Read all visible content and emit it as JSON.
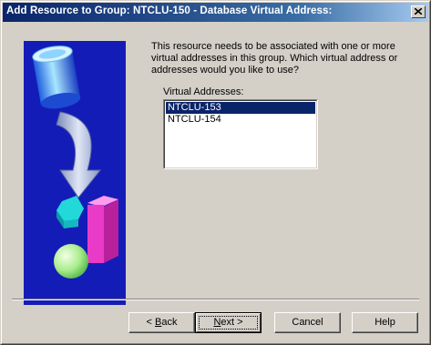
{
  "window": {
    "title": "Add Resource to Group: NTCLU-150 - Database Virtual Address:"
  },
  "message": "This resource needs to be associated with one or more virtual addresses in this group.  Which virtual address or addresses would you like to use?",
  "virtual_addresses": {
    "label": "Virtual Addresses:",
    "items": [
      "NTCLU-153",
      "NTCLU-154"
    ],
    "selected": "NTCLU-153"
  },
  "buttons": {
    "back": {
      "prefix": "< ",
      "mnemonic": "B",
      "rest": "ack"
    },
    "next": {
      "mnemonic": "N",
      "rest": "ext >"
    },
    "cancel": "Cancel",
    "help": "Help"
  },
  "icons": {
    "titlebar_close": "close-icon",
    "wizard_art": "database-cylinder-arrow-shapes-illustration"
  },
  "colors": {
    "titlebar_start": "#0a246a",
    "titlebar_end": "#a6caf0",
    "selection": "#0a246a",
    "art_background": "#141cb8"
  }
}
